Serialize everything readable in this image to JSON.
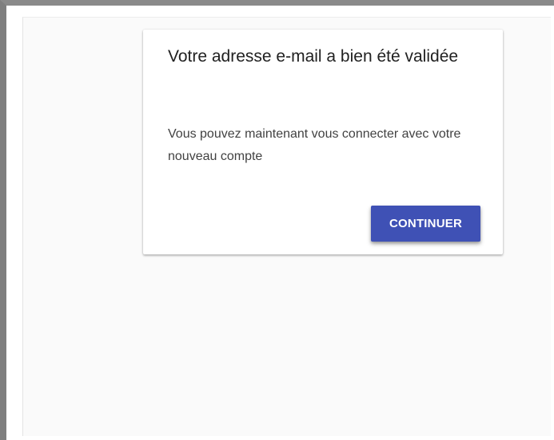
{
  "dialog": {
    "title": "Votre adresse e-mail a bien été validée",
    "message": "Vous pouvez maintenant vous connecter avec votre nouveau compte",
    "continue_label": "CONTINUER"
  },
  "colors": {
    "accent": "#3f51b5",
    "background": "#fafafa",
    "card": "#ffffff",
    "title_text": "#212121",
    "body_text": "#424242"
  }
}
